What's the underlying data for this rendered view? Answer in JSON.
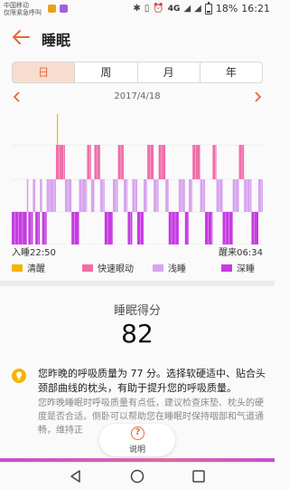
{
  "status_bar": {
    "carrier_line1": "中国移动",
    "carrier_line2": "仅限紧急呼叫",
    "network": "4G",
    "battery": "18%",
    "time": "16:21"
  },
  "header": {
    "title": "睡眠"
  },
  "tabs": [
    {
      "label": "日",
      "active": true
    },
    {
      "label": "周",
      "active": false
    },
    {
      "label": "月",
      "active": false
    },
    {
      "label": "年",
      "active": false
    }
  ],
  "date": "2017/4/18",
  "chart_labels": {
    "sleep_start": "入睡22:50",
    "wake_up": "醒来06:34"
  },
  "legend": [
    {
      "label": "清醒",
      "color": "#f5b400"
    },
    {
      "label": "快速眼动",
      "color": "#f06eaa"
    },
    {
      "label": "浅睡",
      "color": "#d7a4ee"
    },
    {
      "label": "深睡",
      "color": "#c63be0"
    }
  ],
  "score": {
    "title": "睡眠得分",
    "value": "82"
  },
  "advice": {
    "main": "您昨晚的呼吸质量为 77 分。选择软硬适中、贴合头颈部曲线的枕头，有助于提升您的呼吸质量。",
    "sub": "您昨晚睡眠时呼吸质量有点低，建议检查床垫、枕头的硬度是否合适。侧卧可以帮助您在睡眠时保持咽部和气道通畅，维持正"
  },
  "explain_button": {
    "label": "说明"
  },
  "chart_data": {
    "type": "timeline",
    "start": "22:50",
    "end": "06:34",
    "series": [
      {
        "name": "清醒",
        "color": "#f5b400"
      },
      {
        "name": "快速眼动",
        "color": "#f06eaa"
      },
      {
        "name": "浅睡",
        "color": "#d7a4ee"
      },
      {
        "name": "深睡",
        "color": "#c63be0"
      }
    ],
    "segments": [
      [
        0.0,
        0.06,
        3
      ],
      [
        0.06,
        0.066,
        2
      ],
      [
        0.066,
        0.084,
        3
      ],
      [
        0.084,
        0.094,
        2
      ],
      [
        0.094,
        0.112,
        3
      ],
      [
        0.112,
        0.121,
        2
      ],
      [
        0.121,
        0.139,
        3
      ],
      [
        0.18,
        0.184,
        0
      ],
      [
        0.139,
        0.176,
        2
      ],
      [
        0.176,
        0.212,
        1
      ],
      [
        0.212,
        0.238,
        2
      ],
      [
        0.238,
        0.268,
        3
      ],
      [
        0.268,
        0.3,
        2
      ],
      [
        0.3,
        0.316,
        1
      ],
      [
        0.316,
        0.329,
        2
      ],
      [
        0.329,
        0.352,
        1
      ],
      [
        0.352,
        0.37,
        2
      ],
      [
        0.37,
        0.403,
        3
      ],
      [
        0.403,
        0.423,
        2
      ],
      [
        0.423,
        0.446,
        1
      ],
      [
        0.446,
        0.462,
        2
      ],
      [
        0.462,
        0.48,
        3
      ],
      [
        0.48,
        0.5,
        2
      ],
      [
        0.5,
        0.525,
        3
      ],
      [
        0.525,
        0.54,
        2
      ],
      [
        0.54,
        0.565,
        1
      ],
      [
        0.565,
        0.585,
        2
      ],
      [
        0.585,
        0.612,
        1
      ],
      [
        0.612,
        0.625,
        2
      ],
      [
        0.625,
        0.665,
        3
      ],
      [
        0.665,
        0.69,
        2
      ],
      [
        0.69,
        0.705,
        3
      ],
      [
        0.705,
        0.72,
        2
      ],
      [
        0.72,
        0.75,
        1
      ],
      [
        0.75,
        0.77,
        2
      ],
      [
        0.77,
        0.8,
        3
      ],
      [
        0.8,
        0.815,
        1
      ],
      [
        0.815,
        0.84,
        2
      ],
      [
        0.84,
        0.88,
        3
      ],
      [
        0.88,
        0.905,
        2
      ],
      [
        0.905,
        0.925,
        1
      ],
      [
        0.925,
        0.955,
        2
      ],
      [
        0.955,
        0.982,
        3
      ],
      [
        0.982,
        1.0,
        2
      ]
    ]
  }
}
